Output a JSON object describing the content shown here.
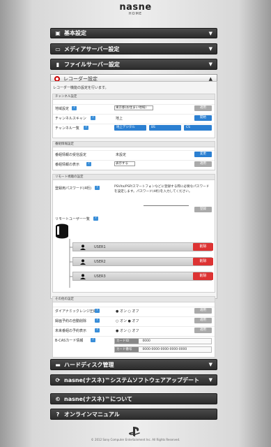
{
  "header": {
    "logo": "nasne",
    "sub": "HOME"
  },
  "menus": {
    "basic": "基本設定",
    "media": "メディアサーバー設定",
    "file": "ファイルサーバー設定",
    "recorder": "レコーダー設定",
    "hdd": "ハードディスク管理",
    "update": "nasne(ナスネ)™システムソフトウェアアップデート",
    "about": "nasne(ナスネ)™について",
    "manual": "オンラインマニュアル"
  },
  "recorder": {
    "desc": "レコーダー機能の設定を行います。",
    "channel": {
      "head": "チャンネル設定",
      "area_label": "地域設定",
      "area_value": "東京都(お住まい地域)",
      "area_btn": "適用",
      "scan_label": "チャンネルスキャン",
      "scan_value": "地上",
      "scan_btn": "開始",
      "list_label": "チャンネル一覧",
      "list_items": [
        "地上デジタル",
        "BS",
        "CS"
      ]
    },
    "program": {
      "head": "番組情報設定",
      "area_label": "番組情報の受信設定",
      "area_value": "未設定",
      "area_btn": "変更",
      "guide_label": "番組情報の表示",
      "guide_value": "表示する",
      "guide_btn": "適用"
    },
    "remote": {
      "head": "リモート視聴の設定",
      "pass_label": "登録用パスワード(4桁)",
      "pass_desc": "PSVita/PSP/スマートフォンなどに登録する際に必要なパスワードを設定します。パスワード(4桁)を入力してください。",
      "pass_btn": "登録",
      "list_label": "リモートユーザー一覧",
      "users": [
        "USER1",
        "USER2",
        "USER3"
      ],
      "del_btn": "削除"
    },
    "other": {
      "head": "その他の設定",
      "rows": [
        {
          "label": "ダイアナミックレンジ圧縮",
          "value": "● オン ○ オフ",
          "btn": "適用"
        },
        {
          "label": "録画予約の自動削除",
          "value": "○ オン ● オフ",
          "btn": "適用"
        },
        {
          "label": "未来番組の予約表示",
          "value": "● オン ○ オフ",
          "btn": "適用"
        }
      ],
      "card_label": "B-CASカード情報",
      "card_id_label": "カードID",
      "card_id_value": "0000",
      "card_no_label": "カード番号",
      "card_no_value": "0000-0000-0000-0000-0000"
    }
  },
  "footer": {
    "copyright": "© 2012 Sony Computer Entertainment Inc. All Rights Reserved."
  }
}
